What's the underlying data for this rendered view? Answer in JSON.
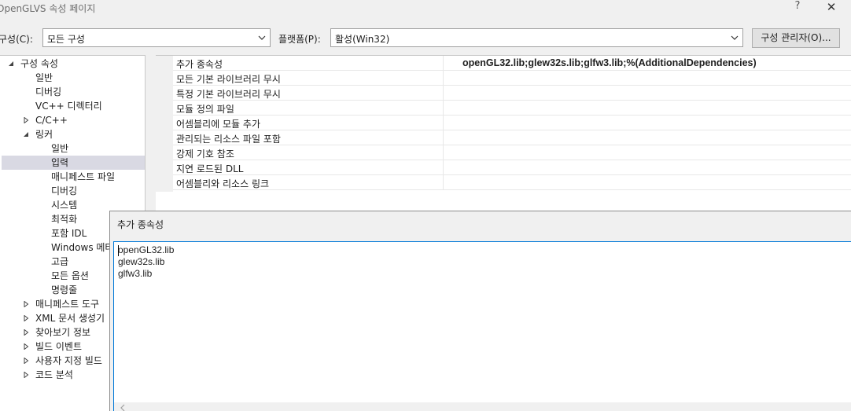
{
  "window": {
    "title": "OpenGLVS 속성 페이지",
    "help_glyph": "?",
    "close_glyph": "✕"
  },
  "toolbar": {
    "config_label": "구성(C):",
    "config_value": "모든 구성",
    "platform_label": "플랫폼(P):",
    "platform_value": "활성(Win32)",
    "config_manager_label": "구성 관리자(O)..."
  },
  "tree": {
    "items": [
      {
        "label": "구성 속성",
        "level": 0,
        "twisty": "expanded"
      },
      {
        "label": "일반",
        "level": 1
      },
      {
        "label": "디버깅",
        "level": 1
      },
      {
        "label": "VC++ 디렉터리",
        "level": 1
      },
      {
        "label": "C/C++",
        "level": 1,
        "twisty": "collapsed"
      },
      {
        "label": "링커",
        "level": 1,
        "twisty": "expanded"
      },
      {
        "label": "일반",
        "level": 2
      },
      {
        "label": "입력",
        "level": 2,
        "selected": true
      },
      {
        "label": "매니페스트 파일",
        "level": 2
      },
      {
        "label": "디버깅",
        "level": 2
      },
      {
        "label": "시스템",
        "level": 2
      },
      {
        "label": "최적화",
        "level": 2
      },
      {
        "label": "포함 IDL",
        "level": 2
      },
      {
        "label": "Windows 메타",
        "level": 2
      },
      {
        "label": "고급",
        "level": 2
      },
      {
        "label": "모든 옵션",
        "level": 2
      },
      {
        "label": "명령줄",
        "level": 2
      },
      {
        "label": "매니페스트 도구",
        "level": 1,
        "twisty": "collapsed"
      },
      {
        "label": "XML 문서 생성기",
        "level": 1,
        "twisty": "collapsed"
      },
      {
        "label": "찾아보기 정보",
        "level": 1,
        "twisty": "collapsed"
      },
      {
        "label": "빌드 이벤트",
        "level": 1,
        "twisty": "collapsed"
      },
      {
        "label": "사용자 지정 빌드",
        "level": 1,
        "twisty": "collapsed"
      },
      {
        "label": "코드 분석",
        "level": 1,
        "twisty": "collapsed"
      }
    ]
  },
  "properties": [
    {
      "name": "추가 종속성",
      "value": "openGL32.lib;glew32s.lib;glfw3.lib;%(AdditionalDependencies)"
    },
    {
      "name": "모든 기본 라이브러리 무시",
      "value": ""
    },
    {
      "name": "특정 기본 라이브러리 무시",
      "value": ""
    },
    {
      "name": "모듈 정의 파일",
      "value": ""
    },
    {
      "name": "어셈블리에 모듈 추가",
      "value": ""
    },
    {
      "name": "관리되는 리소스 파일 포함",
      "value": ""
    },
    {
      "name": "강제 기호 참조",
      "value": ""
    },
    {
      "name": "지연 로드된 DLL",
      "value": ""
    },
    {
      "name": "어셈블리와 리소스 링크",
      "value": ""
    }
  ],
  "dialog": {
    "title": "추가 종속성",
    "lines": [
      "openGL32.lib",
      "glew32s.lib",
      "glfw3.lib"
    ]
  },
  "colors": {
    "selection": "#d9d9e3",
    "focus_border": "#0078d7"
  }
}
